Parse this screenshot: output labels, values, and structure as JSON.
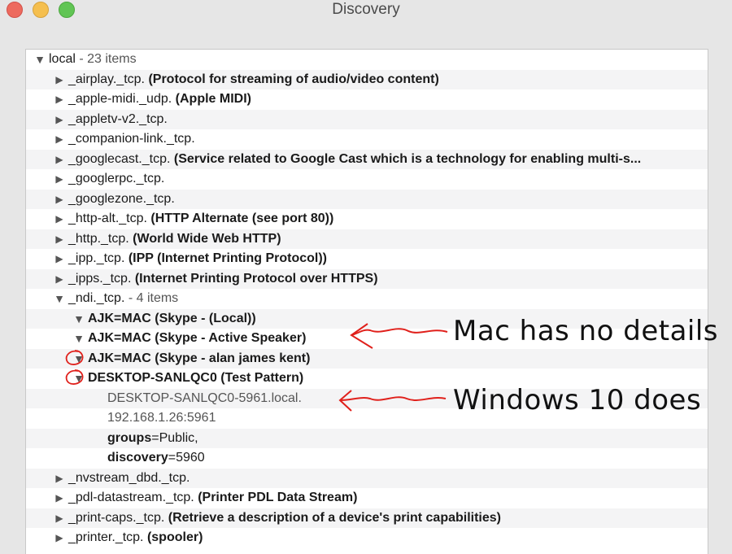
{
  "window": {
    "title": "Discovery"
  },
  "tree": {
    "root": {
      "label": "local",
      "count": " - 23 items"
    },
    "services_before": [
      {
        "name": "_airplay._tcp.",
        "desc": "(Protocol for streaming of audio/video content)"
      },
      {
        "name": "_apple-midi._udp.",
        "desc": "(Apple MIDI)"
      },
      {
        "name": "_appletv-v2._tcp.",
        "desc": ""
      },
      {
        "name": "_companion-link._tcp.",
        "desc": ""
      },
      {
        "name": "_googlecast._tcp.",
        "desc": "(Service related to Google Cast which is a technology for enabling multi-s..."
      },
      {
        "name": "_googlerpc._tcp.",
        "desc": ""
      },
      {
        "name": "_googlezone._tcp.",
        "desc": ""
      },
      {
        "name": "_http-alt._tcp.",
        "desc": "(HTTP Alternate (see port 80))"
      },
      {
        "name": "_http._tcp.",
        "desc": "(World Wide Web HTTP)"
      },
      {
        "name": "_ipp._tcp.",
        "desc": "(IPP (Internet Printing Protocol))"
      },
      {
        "name": "_ipps._tcp.",
        "desc": "(Internet Printing Protocol over HTTPS)"
      }
    ],
    "ndi": {
      "name": "_ndi._tcp.",
      "count": " - 4 items",
      "children": [
        "AJK=MAC (Skype - (Local))",
        "AJK=MAC (Skype - Active Speaker)",
        "AJK=MAC (Skype - alan james kent)",
        "DESKTOP-SANLQC0 (Test Pattern)"
      ],
      "details": {
        "host": "DESKTOP-SANLQC0-5961.local.",
        "address": "192.168.1.26:5961",
        "groups_key": "groups",
        "groups_val": "=Public,",
        "discovery_key": "discovery",
        "discovery_val": "=5960"
      }
    },
    "services_after": [
      {
        "name": "_nvstream_dbd._tcp.",
        "desc": ""
      },
      {
        "name": "_pdl-datastream._tcp.",
        "desc": "(Printer PDL Data Stream)"
      },
      {
        "name": "_print-caps._tcp.",
        "desc": "(Retrieve a description of a device's print capabilities)"
      },
      {
        "name": "_printer._tcp.",
        "desc": "(spooler)"
      }
    ]
  },
  "annotations": {
    "mac": "Mac has no details",
    "windows": "Windows 10 does",
    "color": "#e0201b"
  }
}
